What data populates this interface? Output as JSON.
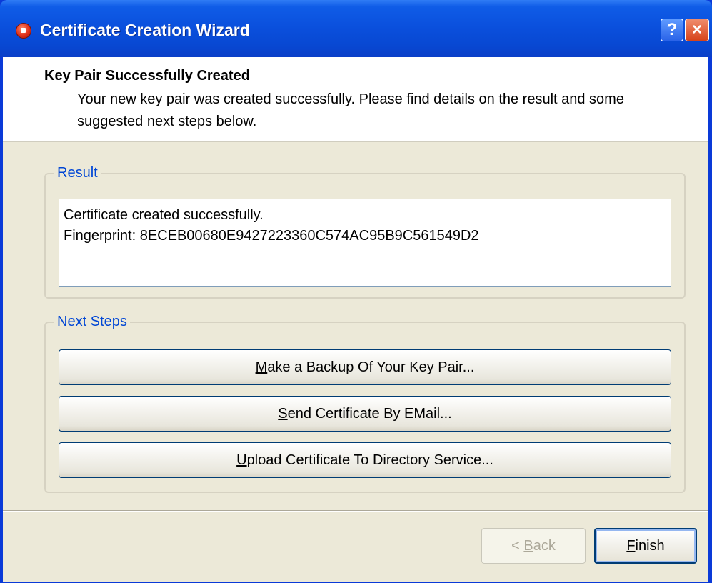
{
  "window": {
    "title": "Certificate Creation Wizard",
    "help_button": "?",
    "close_button": "×"
  },
  "header": {
    "title": "Key Pair Successfully Created",
    "description": "Your new key pair was created successfully. Please find details on the result and some suggested next steps below."
  },
  "result": {
    "legend": "Result",
    "line1": "Certificate created successfully.",
    "line2": "Fingerprint: 8ECEB00680E9427223360C574AC95B9C561549D2"
  },
  "next_steps": {
    "legend": "Next Steps",
    "backup": {
      "mnemonic": "M",
      "rest": "ake a Backup Of Your Key Pair..."
    },
    "email": {
      "mnemonic": "S",
      "rest": "end Certificate By EMail..."
    },
    "upload": {
      "mnemonic": "U",
      "rest": "pload Certificate To Directory Service..."
    }
  },
  "footer": {
    "back": {
      "prefix": "< ",
      "mnemonic": "B",
      "rest": "ack"
    },
    "finish": {
      "mnemonic": "F",
      "rest": "inish"
    }
  },
  "colors": {
    "titlebar": "#0A4FDC",
    "accent_text": "#0046D5",
    "dialog_background": "#ECE9D8"
  },
  "icons": {
    "app": "certificate-app-icon",
    "help": "help-icon",
    "close": "close-icon"
  }
}
